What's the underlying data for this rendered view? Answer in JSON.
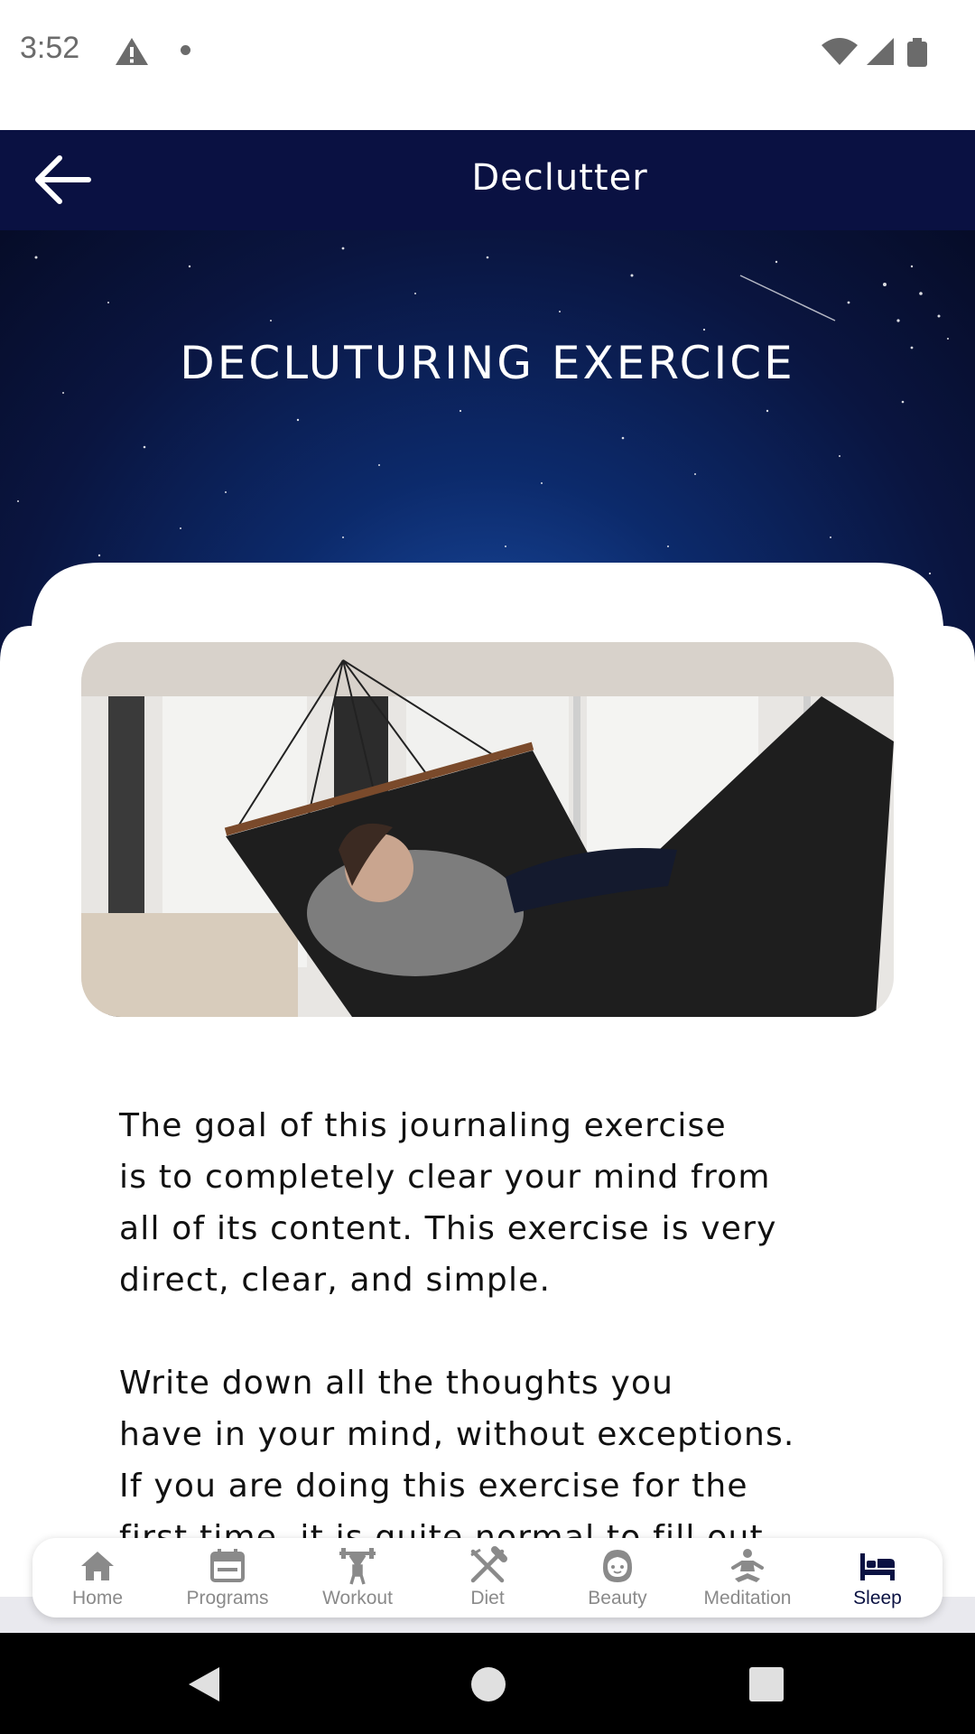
{
  "status_bar": {
    "time": "3:52"
  },
  "app_bar": {
    "title": "Declutter"
  },
  "hero": {
    "title": "DECLUTURING EXERCICE"
  },
  "content": {
    "paragraphs": [
      " The goal of this journaling exercise\nis to completely clear your mind from\nall of its content. This exercise is very\ndirect, clear, and simple.",
      " Write down all the thoughts you\nhave in your mind, without exceptions.\nIf you are doing this exercise for the\nfirst time, it is quite normal to fill out"
    ]
  },
  "bottom_nav": {
    "items": [
      {
        "label": "Home",
        "icon": "home-icon"
      },
      {
        "label": "Programs",
        "icon": "calendar-icon"
      },
      {
        "label": "Workout",
        "icon": "weightlifting-icon"
      },
      {
        "label": "Diet",
        "icon": "utensils-icon"
      },
      {
        "label": "Beauty",
        "icon": "face-icon"
      },
      {
        "label": "Meditation",
        "icon": "meditation-icon"
      },
      {
        "label": "Sleep",
        "icon": "bed-icon"
      }
    ],
    "active": "Sleep"
  },
  "colors": {
    "app_bar": "#0a1142",
    "active_nav": "#0a1142",
    "inactive_nav": "#8a8a8a"
  }
}
